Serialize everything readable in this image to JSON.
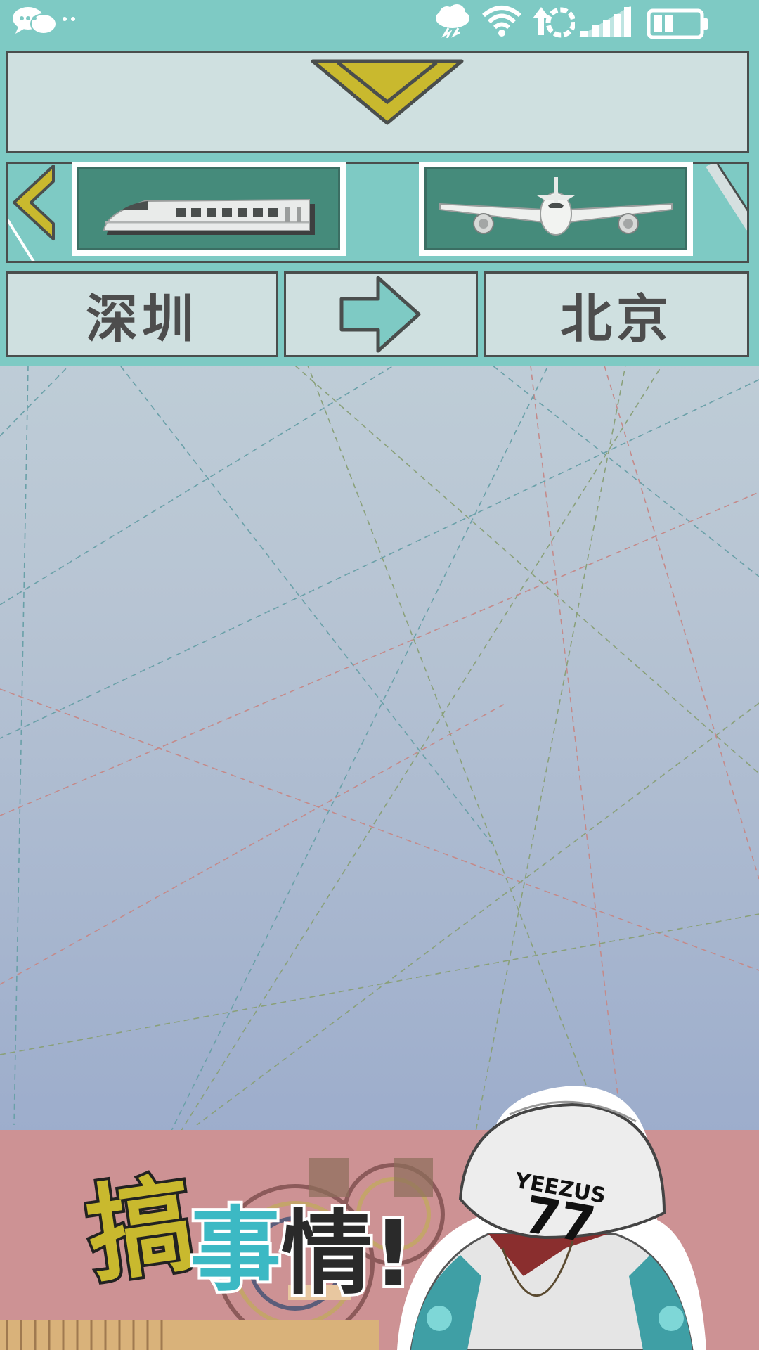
{
  "status_bar": {
    "icons": [
      "chat-bubbles-icon",
      "more-dots-icon",
      "thunderstorm-icon",
      "wifi-icon",
      "sync-icon",
      "signal-icon",
      "battery-icon"
    ]
  },
  "header": {
    "dropdown_icon": "chevron-down-icon"
  },
  "transport": {
    "back_icon": "chevron-left-icon",
    "modes": [
      {
        "icon": "high-speed-train-icon"
      },
      {
        "icon": "airplane-icon"
      }
    ]
  },
  "route": {
    "from": "深圳",
    "to": "北京",
    "arrow_icon": "arrow-right-icon"
  },
  "banner": {
    "slogan": "搞事情!",
    "cap_text": "YEEZUS",
    "cap_number": "77"
  },
  "colors": {
    "frame": "#7ecac4",
    "accent_yellow": "#c9b92e",
    "card_green": "#458b7b",
    "banner_pink": "#cd9294",
    "text_dark": "#4d4d4d"
  }
}
